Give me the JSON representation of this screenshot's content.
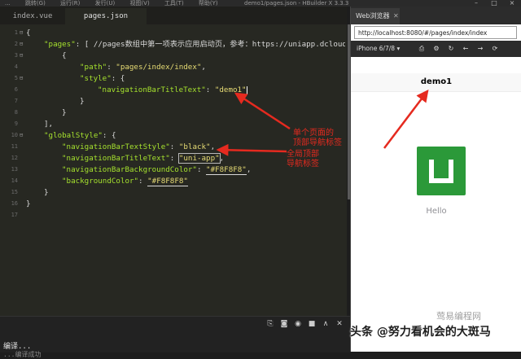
{
  "menubar": {
    "items": [
      "...",
      "跳转(G)",
      "运行(R)",
      "发行(U)",
      "视图(V)",
      "工具(T)",
      "帮助(Y)"
    ],
    "window_title": "demo1/pages.json - HBuilder X 3.3.3"
  },
  "editor": {
    "tabs": [
      "index.vue",
      "pages.json"
    ],
    "active_tab": "pages.json",
    "line_numbers": [
      "1",
      "2",
      "3",
      "4",
      "5",
      "6",
      "7",
      "8",
      "9",
      "10",
      "11",
      "12",
      "13",
      "14",
      "15",
      "16",
      "17"
    ],
    "code": {
      "l1": "{",
      "l2_key": "\"pages\"",
      "l2_rest": ": [ //pages数组中第一项表示应用启动页，参考：https://uniapp.dcloud",
      "l3": "{",
      "l4_key": "\"path\"",
      "l4_val": "\"pages/index/index\"",
      "l5_key": "\"style\"",
      "l5_rest": ": {",
      "l6_key": "\"navigationBarTitleText\"",
      "l6_val": "\"demo1\"",
      "l7": "}",
      "l8": "}",
      "l9": "],",
      "l10_key": "\"globalStyle\"",
      "l10_rest": ": {",
      "l11_key": "\"navigationBarTextStyle\"",
      "l11_val": "\"black\"",
      "l12_key": "\"navigationBarTitleText\"",
      "l12_val": "\"uni-app\"",
      "l13_key": "\"navigationBarBackgroundColor\"",
      "l13_val": "\"#F8F8F8\"",
      "l14_key": "\"backgroundColor\"",
      "l14_val": "\"#F8F8F8\"",
      "l15": "}",
      "l16": "}"
    }
  },
  "status": {
    "compile_text": "编译...",
    "compile_text2": "...编译成功",
    "icons": [
      "terminal-icon",
      "stop-icon",
      "record-icon",
      "square-icon",
      "chevron-up-icon",
      "close-icon"
    ]
  },
  "browser": {
    "tab_label": "Web浏览器",
    "url": "http://localhost:8080/#/pages/index/index",
    "device": "iPhone 6/7/8",
    "toolbar_icons": [
      "screenshot-icon",
      "settings-icon",
      "refresh-icon",
      "back-icon",
      "forward-icon",
      "reload-icon"
    ],
    "page_title": "demo1",
    "hello_text": "Hello"
  },
  "annotations": {
    "single_page": "单个页面的\n顶部导航标签",
    "global": "全局顶部\n导航标签"
  },
  "watermark": {
    "line1": "莺易编程网",
    "line2": "头条 @努力看机会的大斑马"
  },
  "colors": {
    "arrow": "#e52a1f",
    "logo_green": "#2b9939",
    "editor_bg": "#272822"
  }
}
